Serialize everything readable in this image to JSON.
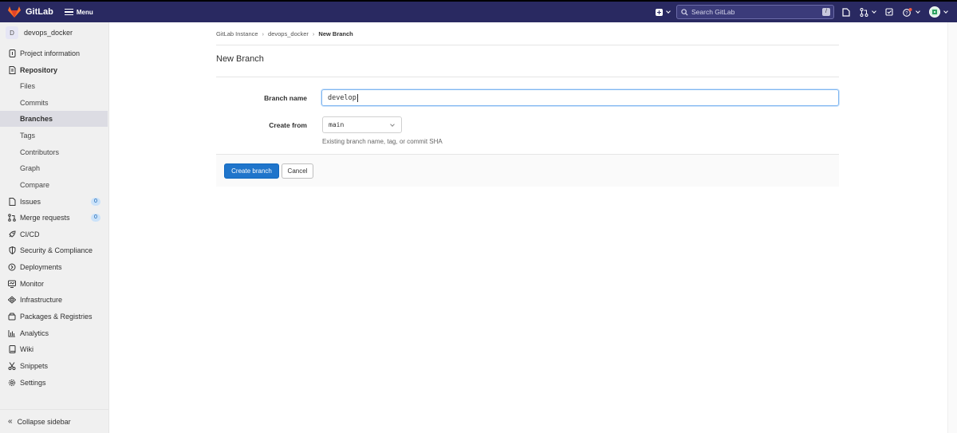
{
  "app": {
    "name": "GitLab",
    "menu_label": "Menu"
  },
  "topbar": {
    "search_placeholder": "Search GitLab",
    "search_shortcut": "/",
    "icons": [
      "plus-square-icon",
      "issues-icon",
      "merge-request-icon",
      "todo-icon",
      "help-icon",
      "user-avatar-icon"
    ]
  },
  "project": {
    "initial": "D",
    "name": "devops_docker"
  },
  "sidebar": {
    "items": [
      {
        "label": "Project information",
        "icon": "info-icon"
      },
      {
        "label": "Repository",
        "icon": "repository-icon"
      },
      {
        "label": "Issues",
        "icon": "issues-icon",
        "badge": "0"
      },
      {
        "label": "Merge requests",
        "icon": "merge-request-icon",
        "badge": "0"
      },
      {
        "label": "CI/CD",
        "icon": "rocket-icon"
      },
      {
        "label": "Security & Compliance",
        "icon": "shield-icon"
      },
      {
        "label": "Deployments",
        "icon": "deployments-icon"
      },
      {
        "label": "Monitor",
        "icon": "monitor-icon"
      },
      {
        "label": "Infrastructure",
        "icon": "cloud-icon"
      },
      {
        "label": "Packages & Registries",
        "icon": "package-icon"
      },
      {
        "label": "Analytics",
        "icon": "chart-icon"
      },
      {
        "label": "Wiki",
        "icon": "book-icon"
      },
      {
        "label": "Snippets",
        "icon": "scissors-icon"
      },
      {
        "label": "Settings",
        "icon": "gear-icon"
      }
    ],
    "repo_sub": [
      "Files",
      "Commits",
      "Branches",
      "Tags",
      "Contributors",
      "Graph",
      "Compare"
    ],
    "collapse_label": "Collapse sidebar"
  },
  "breadcrumb": [
    "GitLab Instance",
    "devops_docker",
    "New Branch"
  ],
  "page": {
    "title": "New Branch",
    "branch_name_label": "Branch name",
    "branch_name_value": "develop",
    "create_from_label": "Create from",
    "create_from_value": "main",
    "create_from_help": "Existing branch name, tag, or commit SHA",
    "create_button": "Create branch",
    "cancel_button": "Cancel"
  },
  "colors": {
    "navbar": "#292961",
    "primary_button": "#1f75cb",
    "badge_bg": "#cbe2f9"
  }
}
